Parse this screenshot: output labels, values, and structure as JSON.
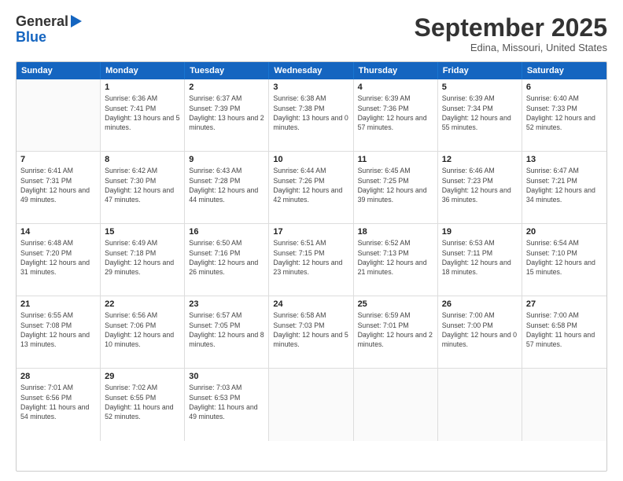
{
  "header": {
    "logo_line1": "General",
    "logo_line2": "Blue",
    "month": "September 2025",
    "location": "Edina, Missouri, United States"
  },
  "days_of_week": [
    "Sunday",
    "Monday",
    "Tuesday",
    "Wednesday",
    "Thursday",
    "Friday",
    "Saturday"
  ],
  "weeks": [
    [
      {
        "day": "",
        "empty": true
      },
      {
        "day": "1",
        "sunrise": "6:36 AM",
        "sunset": "7:41 PM",
        "daylight": "13 hours and 5 minutes."
      },
      {
        "day": "2",
        "sunrise": "6:37 AM",
        "sunset": "7:39 PM",
        "daylight": "13 hours and 2 minutes."
      },
      {
        "day": "3",
        "sunrise": "6:38 AM",
        "sunset": "7:38 PM",
        "daylight": "13 hours and 0 minutes."
      },
      {
        "day": "4",
        "sunrise": "6:39 AM",
        "sunset": "7:36 PM",
        "daylight": "12 hours and 57 minutes."
      },
      {
        "day": "5",
        "sunrise": "6:39 AM",
        "sunset": "7:34 PM",
        "daylight": "12 hours and 55 minutes."
      },
      {
        "day": "6",
        "sunrise": "6:40 AM",
        "sunset": "7:33 PM",
        "daylight": "12 hours and 52 minutes."
      }
    ],
    [
      {
        "day": "7",
        "sunrise": "6:41 AM",
        "sunset": "7:31 PM",
        "daylight": "12 hours and 49 minutes."
      },
      {
        "day": "8",
        "sunrise": "6:42 AM",
        "sunset": "7:30 PM",
        "daylight": "12 hours and 47 minutes."
      },
      {
        "day": "9",
        "sunrise": "6:43 AM",
        "sunset": "7:28 PM",
        "daylight": "12 hours and 44 minutes."
      },
      {
        "day": "10",
        "sunrise": "6:44 AM",
        "sunset": "7:26 PM",
        "daylight": "12 hours and 42 minutes."
      },
      {
        "day": "11",
        "sunrise": "6:45 AM",
        "sunset": "7:25 PM",
        "daylight": "12 hours and 39 minutes."
      },
      {
        "day": "12",
        "sunrise": "6:46 AM",
        "sunset": "7:23 PM",
        "daylight": "12 hours and 36 minutes."
      },
      {
        "day": "13",
        "sunrise": "6:47 AM",
        "sunset": "7:21 PM",
        "daylight": "12 hours and 34 minutes."
      }
    ],
    [
      {
        "day": "14",
        "sunrise": "6:48 AM",
        "sunset": "7:20 PM",
        "daylight": "12 hours and 31 minutes."
      },
      {
        "day": "15",
        "sunrise": "6:49 AM",
        "sunset": "7:18 PM",
        "daylight": "12 hours and 29 minutes."
      },
      {
        "day": "16",
        "sunrise": "6:50 AM",
        "sunset": "7:16 PM",
        "daylight": "12 hours and 26 minutes."
      },
      {
        "day": "17",
        "sunrise": "6:51 AM",
        "sunset": "7:15 PM",
        "daylight": "12 hours and 23 minutes."
      },
      {
        "day": "18",
        "sunrise": "6:52 AM",
        "sunset": "7:13 PM",
        "daylight": "12 hours and 21 minutes."
      },
      {
        "day": "19",
        "sunrise": "6:53 AM",
        "sunset": "7:11 PM",
        "daylight": "12 hours and 18 minutes."
      },
      {
        "day": "20",
        "sunrise": "6:54 AM",
        "sunset": "7:10 PM",
        "daylight": "12 hours and 15 minutes."
      }
    ],
    [
      {
        "day": "21",
        "sunrise": "6:55 AM",
        "sunset": "7:08 PM",
        "daylight": "12 hours and 13 minutes."
      },
      {
        "day": "22",
        "sunrise": "6:56 AM",
        "sunset": "7:06 PM",
        "daylight": "12 hours and 10 minutes."
      },
      {
        "day": "23",
        "sunrise": "6:57 AM",
        "sunset": "7:05 PM",
        "daylight": "12 hours and 8 minutes."
      },
      {
        "day": "24",
        "sunrise": "6:58 AM",
        "sunset": "7:03 PM",
        "daylight": "12 hours and 5 minutes."
      },
      {
        "day": "25",
        "sunrise": "6:59 AM",
        "sunset": "7:01 PM",
        "daylight": "12 hours and 2 minutes."
      },
      {
        "day": "26",
        "sunrise": "7:00 AM",
        "sunset": "7:00 PM",
        "daylight": "12 hours and 0 minutes."
      },
      {
        "day": "27",
        "sunrise": "7:00 AM",
        "sunset": "6:58 PM",
        "daylight": "11 hours and 57 minutes."
      }
    ],
    [
      {
        "day": "28",
        "sunrise": "7:01 AM",
        "sunset": "6:56 PM",
        "daylight": "11 hours and 54 minutes."
      },
      {
        "day": "29",
        "sunrise": "7:02 AM",
        "sunset": "6:55 PM",
        "daylight": "11 hours and 52 minutes."
      },
      {
        "day": "30",
        "sunrise": "7:03 AM",
        "sunset": "6:53 PM",
        "daylight": "11 hours and 49 minutes."
      },
      {
        "day": "",
        "empty": true
      },
      {
        "day": "",
        "empty": true
      },
      {
        "day": "",
        "empty": true
      },
      {
        "day": "",
        "empty": true
      }
    ]
  ]
}
